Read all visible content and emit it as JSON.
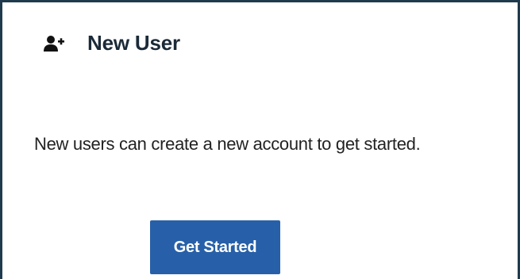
{
  "card": {
    "title": "New User",
    "icon": "user-plus-icon",
    "description": "New users can create a new account to get started.",
    "button_label": "Get Started"
  },
  "colors": {
    "border": "#1f3a4d",
    "title": "#1b2a38",
    "button_bg": "#2760a8",
    "button_text": "#ffffff"
  }
}
